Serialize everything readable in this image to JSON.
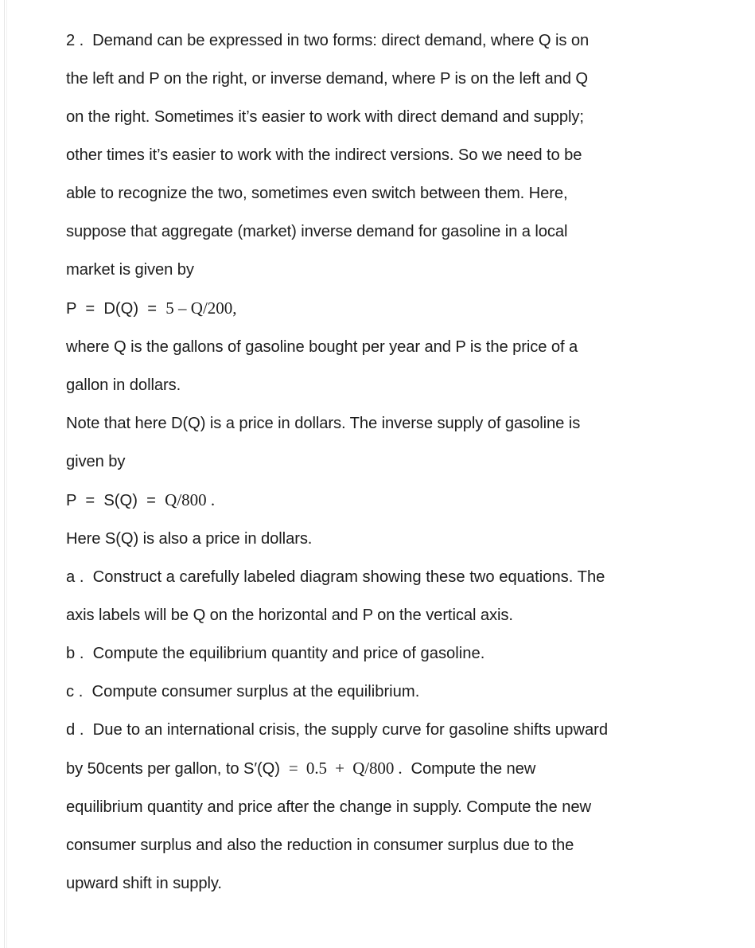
{
  "document": {
    "type": "homework-problem",
    "background_color": "#ffffff",
    "text_color": "#1c1c1c",
    "problem_number": "2 .",
    "lines": [
      {
        "id": "l1",
        "kind": "prose",
        "text": "2 .  Demand can be expressed in two forms: direct demand, where Q is on"
      },
      {
        "id": "l2",
        "kind": "prose",
        "text": "the left and P on the right, or inverse demand, where P is on the left and Q"
      },
      {
        "id": "l3",
        "kind": "prose",
        "text": "on the right. Sometimes it’s easier to work with direct demand and supply;"
      },
      {
        "id": "l4",
        "kind": "prose",
        "text": "other times it’s easier to work with the indirect versions. So we need to be"
      },
      {
        "id": "l5",
        "kind": "prose",
        "text": "able to recognize the two, sometimes even switch between them. Here,"
      },
      {
        "id": "l6",
        "kind": "prose",
        "text": "suppose that aggregate (market) inverse demand for gasoline in a local"
      },
      {
        "id": "l7",
        "kind": "prose",
        "text": "market is given by"
      },
      {
        "id": "l8",
        "kind": "equation",
        "text": "P  =  D(Q)  =  5 – Q/200,"
      },
      {
        "id": "l9",
        "kind": "prose",
        "text": "where Q is the gallons of gasoline bought per year and P is the price of a"
      },
      {
        "id": "l10",
        "kind": "prose",
        "text": "gallon in dollars."
      },
      {
        "id": "l11",
        "kind": "prose",
        "text": "Note that here D(Q) is a price in dollars. The inverse supply of gasoline is"
      },
      {
        "id": "l12",
        "kind": "prose",
        "text": "given by"
      },
      {
        "id": "l13",
        "kind": "equation",
        "text": "P  =  S(Q)  =  Q/800 ."
      },
      {
        "id": "l14",
        "kind": "prose",
        "text": "Here S(Q) is also a price in dollars."
      },
      {
        "id": "l15",
        "kind": "prose",
        "text": "a .  Construct a carefully labeled diagram showing these two equations. The"
      },
      {
        "id": "l16",
        "kind": "prose",
        "text": "axis labels will be Q on the horizontal and P on the vertical axis."
      },
      {
        "id": "l17",
        "kind": "prose",
        "text": "b .  Compute the equilibrium quantity and price of gasoline."
      },
      {
        "id": "l18",
        "kind": "prose",
        "text": "c .  Compute consumer surplus at the equilibrium."
      },
      {
        "id": "l19",
        "kind": "prose",
        "text": "d .  Due to an international crisis, the supply curve for gasoline shifts upward"
      },
      {
        "id": "l20",
        "kind": "mixed",
        "text": "by 50cents per gallon, to S′(Q)  =  0.5  +  Q/800 .  Compute the new"
      },
      {
        "id": "l21",
        "kind": "prose",
        "text": "equilibrium quantity and price after the change in supply. Compute the new"
      },
      {
        "id": "l22",
        "kind": "prose",
        "text": "consumer surplus and also the reduction in consumer surplus due to the"
      },
      {
        "id": "l23",
        "kind": "prose",
        "text": "upward shift in supply."
      }
    ],
    "equations": {
      "inverse_demand": "P  =  D(Q)  =  5 – Q/200,",
      "inverse_supply": "P  =  S(Q)  =  Q/800 .",
      "shifted_supply": "S′(Q)  =  0.5  +  Q/800 ."
    },
    "subparts": [
      {
        "label": "a .",
        "text": "Construct a carefully labeled diagram showing these two equations. The axis labels will be Q on the horizontal and P on the vertical axis."
      },
      {
        "label": "b .",
        "text": "Compute the equilibrium quantity and price of gasoline."
      },
      {
        "label": "c .",
        "text": "Compute consumer surplus at the equilibrium."
      },
      {
        "label": "d .",
        "text": "Due to an international crisis, the supply curve for gasoline shifts upward by 50cents per gallon, to S′(Q)  =  0.5  +  Q/800 .  Compute the new equilibrium quantity and price after the change in supply. Compute the new consumer surplus and also the reduction in consumer surplus due to the upward shift in supply."
      }
    ],
    "equation_parts": {
      "demand_lhs": "P  =  D(Q)  =  ",
      "demand_rhs": "5 – Q/200,",
      "supply_lhs": "P  =  S(Q)  =  ",
      "supply_rhs": "Q/800 .",
      "d_prefix": "by 50cents per gallon, to S′(Q)  ",
      "d_math": "=  0.5  +  Q/800 .",
      "d_suffix": "  Compute the new"
    }
  }
}
